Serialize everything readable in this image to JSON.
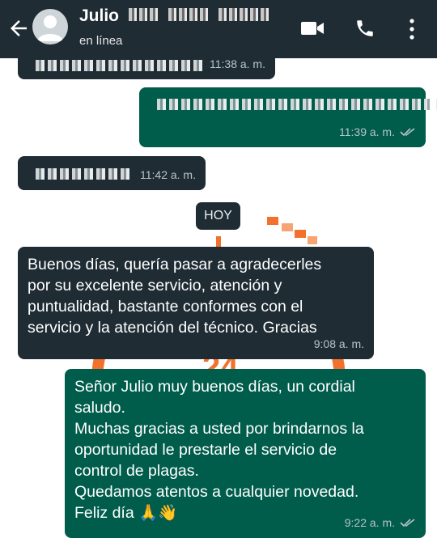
{
  "header": {
    "contact_name": "Julio",
    "status": "en línea",
    "icons": [
      "back-arrow-icon",
      "avatar-placeholder-icon",
      "video-call-icon",
      "phone-call-icon",
      "more-options-icon"
    ]
  },
  "messages": [
    {
      "direction": "in",
      "time": "11:38 a. m.",
      "redacted": true
    },
    {
      "direction": "out",
      "time": "11:39 a. m.",
      "redacted": true,
      "status": "read"
    },
    {
      "direction": "in",
      "time": "11:42 a. m.",
      "redacted": true
    },
    {
      "direction": "in",
      "time": "9:08 a. m.",
      "text": "Buenos días, quería pasar a agradecerles\npor su excelente servicio, atención y\npuntualidad, bastante conformes con el\nservicio y la atención del técnico. Gracias"
    },
    {
      "direction": "out",
      "time": "9:22 a. m.",
      "status": "read",
      "text": "Señor Julio muy buenos días, un cordial\nsaludo.\nMuchas gracias a usted por brindarnos la\noportunidad le prestarle el servicio de\ncontrol de plagas.\nQuedamos atentos a cualquier novedad.\nFeliz día 🙏👋"
    }
  ],
  "day_separator": "HOY",
  "colors": {
    "header_bg": "#1f2c34",
    "incoming_bubble": "#1f2c34",
    "outgoing_bubble": "#005c4b",
    "watermark_orange": "#f26a21"
  }
}
